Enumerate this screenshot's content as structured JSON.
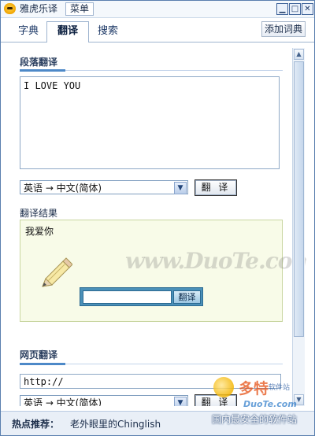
{
  "titlebar": {
    "app_title": "雅虎乐译",
    "menu_label": "菜单",
    "min_symbol": "▁",
    "max_symbol": "□",
    "close_symbol": "✕"
  },
  "tabs": {
    "dict": "字典",
    "translate": "翻译",
    "search": "搜索",
    "add_dict": "添加词典"
  },
  "paragraph": {
    "title": "段落翻译",
    "source_text": "I LOVE YOU",
    "lang_select": "英语 → 中文(简体)",
    "translate_button": "翻 译"
  },
  "result": {
    "label": "翻译结果",
    "text": "我爱你",
    "mini_button": "翻译"
  },
  "webpage": {
    "title": "网页翻译",
    "url_value": "http://",
    "lang_select": "英语 → 中文(简体)",
    "translate_button": "翻 译"
  },
  "statusbar": {
    "hot_label": "热点推荐：",
    "hot_link": "老外眼里的Chinglish"
  },
  "watermarks": {
    "duote_center": "www.DuoTe.com",
    "duote_brand": "多特",
    "duote_sub": "软件站",
    "duote_site": "DuoTe.com",
    "duote_slogan": "国内最安全的软件站"
  },
  "colors": {
    "window_border": "#5a7fae",
    "accent": "#4d89c8",
    "result_bg": "#f8fbe8"
  }
}
